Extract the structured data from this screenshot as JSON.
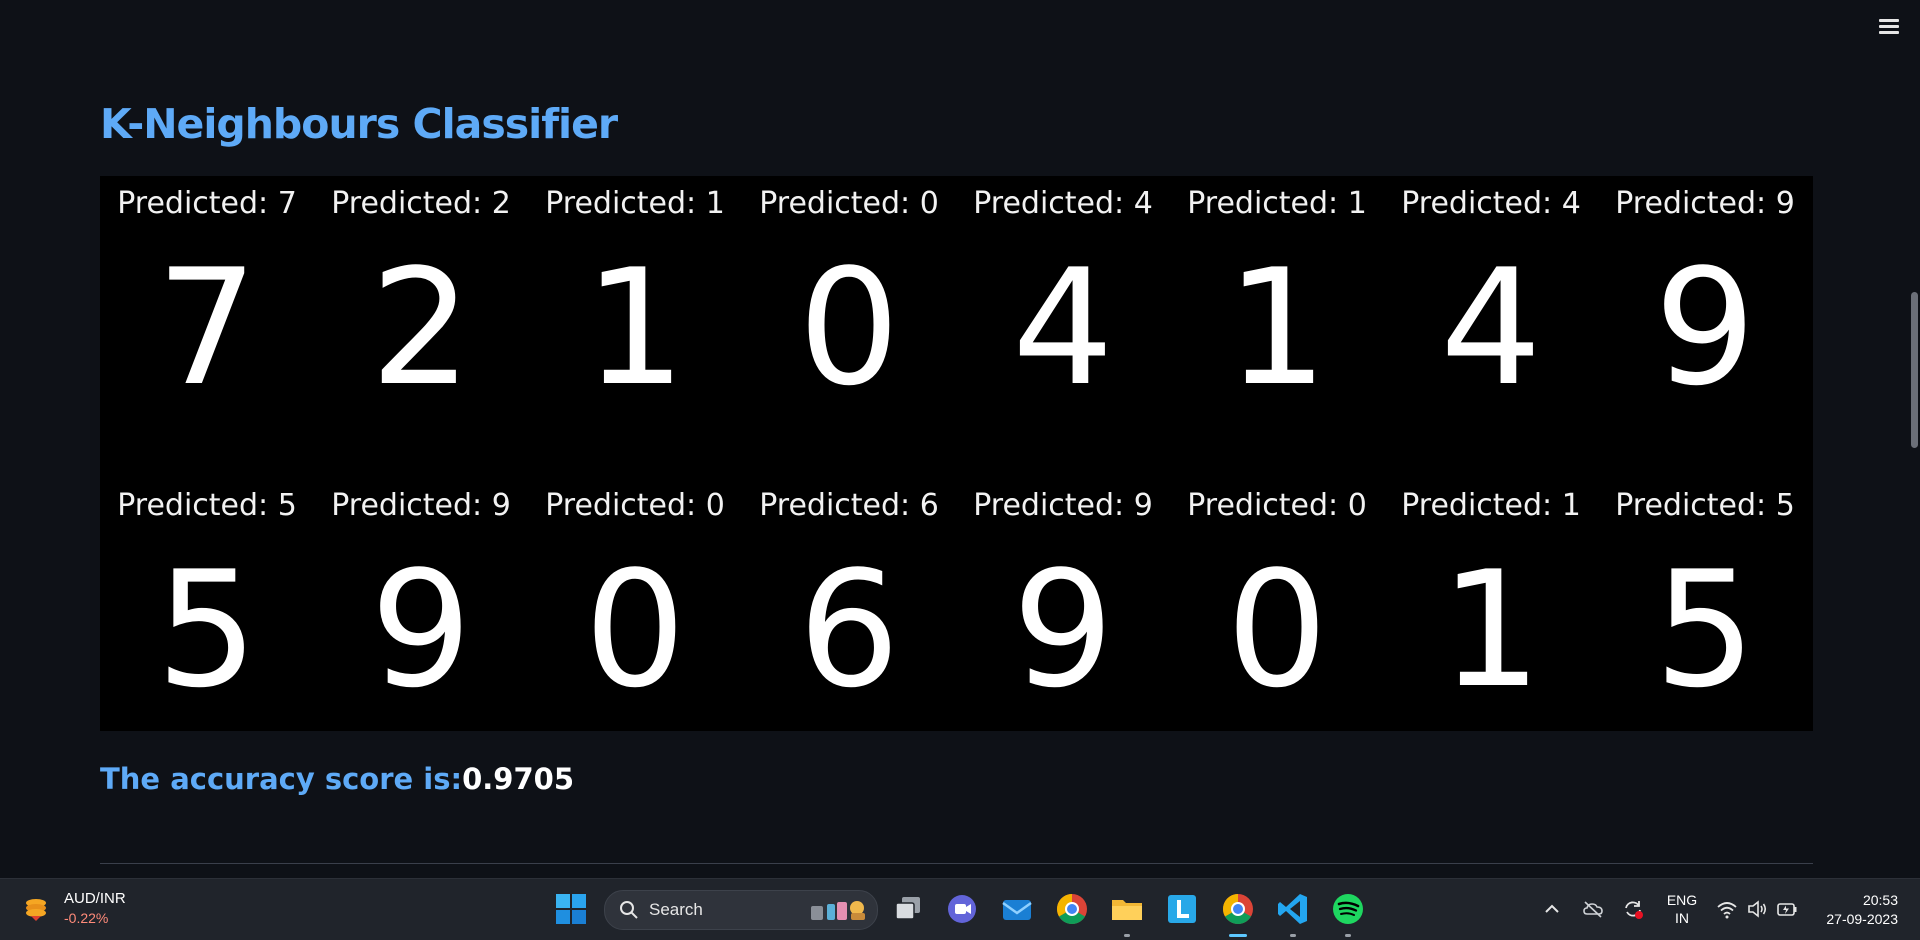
{
  "app": {
    "menu_icon": "hamburger-menu-icon",
    "title": "K-Neighbours Classifier",
    "predictions": [
      {
        "caption": "Predicted: 7",
        "digit": "7"
      },
      {
        "caption": "Predicted: 2",
        "digit": "2"
      },
      {
        "caption": "Predicted: 1",
        "digit": "1"
      },
      {
        "caption": "Predicted: 0",
        "digit": "0"
      },
      {
        "caption": "Predicted: 4",
        "digit": "4"
      },
      {
        "caption": "Predicted: 1",
        "digit": "1"
      },
      {
        "caption": "Predicted: 4",
        "digit": "4"
      },
      {
        "caption": "Predicted: 9",
        "digit": "9"
      },
      {
        "caption": "Predicted: 5",
        "digit": "5"
      },
      {
        "caption": "Predicted: 9",
        "digit": "9"
      },
      {
        "caption": "Predicted: 0",
        "digit": "0"
      },
      {
        "caption": "Predicted: 6",
        "digit": "6"
      },
      {
        "caption": "Predicted: 9",
        "digit": "9"
      },
      {
        "caption": "Predicted: 0",
        "digit": "0"
      },
      {
        "caption": "Predicted: 1",
        "digit": "1"
      },
      {
        "caption": "Predicted: 5",
        "digit": "5"
      }
    ],
    "accuracy_label": "The accuracy score is:",
    "accuracy_value": "0.9705",
    "colors": {
      "background": "#0e1117",
      "accent": "#5eaaf7",
      "figure_bg": "#000000"
    }
  },
  "taskbar": {
    "widget": {
      "icon": "stock-coins-icon",
      "ticker": "AUD/INR",
      "change": "-0.22%"
    },
    "search": {
      "label": "Search",
      "icon": "search-icon"
    },
    "apps": [
      {
        "name": "windows-start-icon"
      },
      {
        "name": "task-view-icon"
      },
      {
        "name": "teams-chat-icon"
      },
      {
        "name": "mail-icon"
      },
      {
        "name": "chrome-icon"
      },
      {
        "name": "file-explorer-icon"
      },
      {
        "name": "l-app-icon"
      },
      {
        "name": "chrome-active-icon"
      },
      {
        "name": "vscode-icon"
      },
      {
        "name": "spotify-icon"
      }
    ],
    "tray": {
      "icons": [
        "chevron-up-icon",
        "onedrive-offline-icon",
        "sync-icon",
        "wifi-icon",
        "volume-icon",
        "battery-icon"
      ],
      "lang_top": "ENG",
      "lang_bottom": "IN",
      "time": "20:53",
      "date": "27-09-2023"
    }
  }
}
